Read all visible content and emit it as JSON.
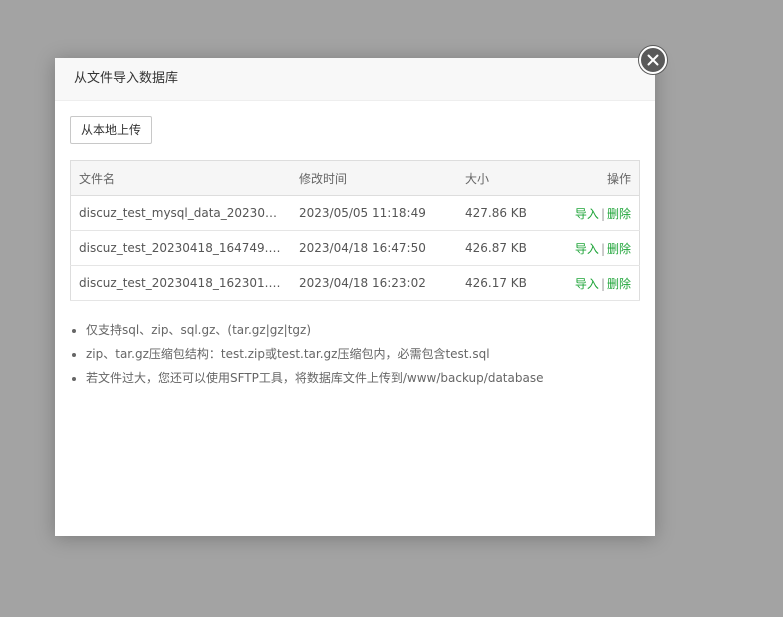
{
  "dialog": {
    "title": "从文件导入数据库",
    "upload_label": "从本地上传"
  },
  "table": {
    "headers": [
      "文件名",
      "修改时间",
      "大小",
      "操作"
    ],
    "rows": [
      {
        "name": "discuz_test_mysql_data_20230505...",
        "time": "2023/05/05 11:18:49",
        "size": "427.86 KB",
        "import": "导入",
        "sep": "|",
        "delete": "删除"
      },
      {
        "name": "discuz_test_20230418_164749.sql....",
        "time": "2023/04/18 16:47:50",
        "size": "426.87 KB",
        "import": "导入",
        "sep": "|",
        "delete": "删除"
      },
      {
        "name": "discuz_test_20230418_162301.sql....",
        "time": "2023/04/18 16:23:02",
        "size": "426.17 KB",
        "import": "导入",
        "sep": "|",
        "delete": "删除"
      }
    ]
  },
  "tips": [
    "仅支持sql、zip、sql.gz、(tar.gz|gz|tgz)",
    "zip、tar.gz压缩包结构：test.zip或test.tar.gz压缩包内，必需包含test.sql",
    "若文件过大，您还可以使用SFTP工具，将数据库文件上传到/www/backup/database"
  ],
  "colors": {
    "accent": "#20a53a",
    "overlay": "#a3a3a3",
    "close_button": "#5a5a5a"
  },
  "icons": {
    "close": "close-icon"
  }
}
